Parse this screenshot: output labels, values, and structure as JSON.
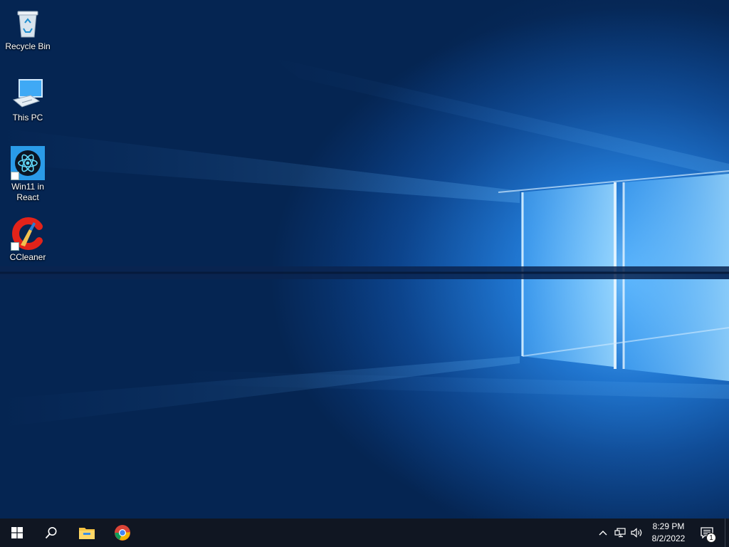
{
  "desktop": {
    "icons": [
      {
        "label": "Recycle Bin",
        "icon": "recycle-bin-icon"
      },
      {
        "label": "This PC",
        "icon": "computer-icon"
      },
      {
        "label": "Win11 in React",
        "icon": "react-app-icon"
      },
      {
        "label": "CCleaner",
        "icon": "ccleaner-icon"
      }
    ]
  },
  "taskbar": {
    "start_icon": "windows-logo-icon",
    "search_icon": "search-icon",
    "pinned": [
      {
        "name": "File Explorer",
        "icon": "folder-icon"
      },
      {
        "name": "Google Chrome",
        "icon": "chrome-icon"
      }
    ],
    "tray": {
      "chevron_icon": "chevron-up-icon",
      "network_icon": "network-icon",
      "volume_icon": "speaker-icon",
      "time": "8:29 PM",
      "date": "8/2/2022",
      "notification_icon": "action-center-icon",
      "notification_count": "1"
    }
  },
  "colors": {
    "taskbar_bg": "#101622",
    "wallpaper_dark": "#052552",
    "wallpaper_light": "#2f8fe6"
  }
}
